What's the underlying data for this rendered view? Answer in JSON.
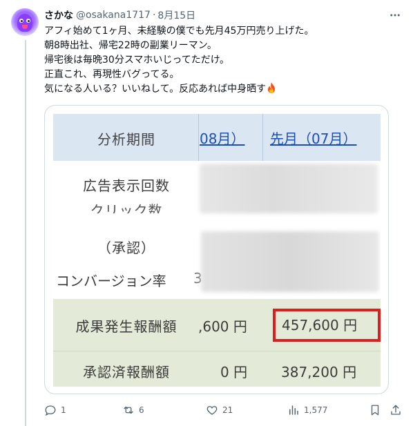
{
  "tweet": {
    "display_name": "さかな",
    "handle": "@osakana1717",
    "separator": "·",
    "date": "8月15日",
    "lines": [
      "アフィ始めて1ヶ月、未経験の僕でも先月45万円売り上げた。",
      "朝8時出社、帰宅22時の副業リーマン。",
      "帰宅後は毎晩30分スマホいじってただけ。",
      "正直これ、再現性バグってる。",
      "気になる人いる？いいねして。反応あれば中身晒す"
    ]
  },
  "table": {
    "header_label": "分析期間",
    "header_col1": "08月）",
    "header_col2": "先月（07月）",
    "row_ad_label": "広告表示回数",
    "row_click_label": "クリック数",
    "row_approve_label": "（承認）",
    "row_cv_label": "コンバージョン率",
    "row_cv_fragment": "3",
    "row_gen_label": "成果発生報酬額",
    "row_gen_col1": ",600 円",
    "row_gen_col2": "457,600 円",
    "row_app_label": "承認済報酬額",
    "row_app_col1": "0 円",
    "row_app_col2": "387,200 円"
  },
  "actions": {
    "reply_count": "1",
    "retweet_count": "6",
    "like_count": "21",
    "view_count": "1,577"
  },
  "icons": {
    "more": "more-icon",
    "reply": "reply-icon",
    "retweet": "retweet-icon",
    "like": "heart-icon",
    "views": "views-icon",
    "bookmark": "bookmark-icon",
    "share": "share-icon",
    "fire": "fire-emoji-icon"
  },
  "colors": {
    "highlight_box": "#e01d1d",
    "header_bg": "#dbe6f3",
    "reward_bg": "#e3ebd8",
    "link": "#1a4fb8"
  }
}
